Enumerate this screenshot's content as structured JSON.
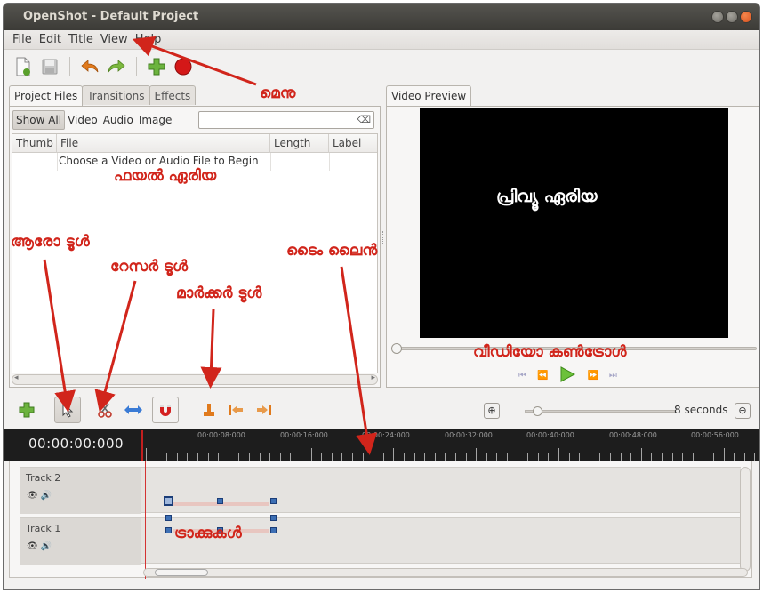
{
  "window": {
    "title": "OpenShot - Default Project"
  },
  "menu": [
    "File",
    "Edit",
    "Title",
    "View",
    "Help"
  ],
  "left_tabs": [
    "Project Files",
    "Transitions",
    "Effects"
  ],
  "filters": [
    "Show All",
    "Video",
    "Audio",
    "Image"
  ],
  "file_columns": [
    "Thumb",
    "File",
    "Length",
    "Label"
  ],
  "file_hint": "Choose a Video or Audio File to Begin",
  "preview_tab": "Video Preview",
  "zoom_label": "8 seconds",
  "timecode": "00:00:00:000",
  "ruler_marks": [
    "00:00:08:000",
    "00:00:16:000",
    "00:00:24:000",
    "00:00:32:000",
    "00:00:40:000",
    "00:00:48:000",
    "00:00:56:000"
  ],
  "tracks": [
    "Track 2",
    "Track 1"
  ],
  "annotations": {
    "menu": "മെനു",
    "file_area": "ഫയൽ ഏരിയ",
    "preview_area": "പ്രിവ്യൂ ഏരിയ",
    "arrow_tool": "ആരോ ടൂൾ",
    "razor_tool": "റേസർ ടൂൾ",
    "marker_tool": "മാർക്കർ ടൂൾ",
    "timeline": "ടൈം ലൈൻ",
    "video_control": "വീഡിയോ കൺട്രോൾ",
    "tracks": "ട്രാക്കുകൾ"
  },
  "colors": {
    "annotation": "#d1251b",
    "titlebar": "#3c3b37",
    "playhead": "#c21f1f"
  }
}
